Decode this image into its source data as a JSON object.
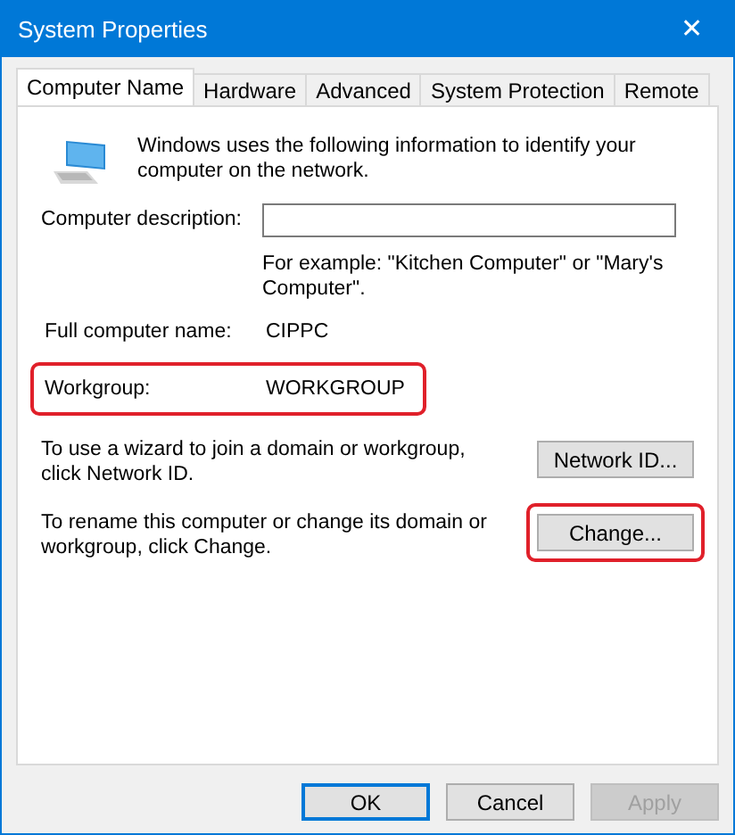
{
  "window": {
    "title": "System Properties",
    "close": "✕"
  },
  "tabs": [
    {
      "label": "Computer Name",
      "selected": true
    },
    {
      "label": "Hardware",
      "selected": false
    },
    {
      "label": "Advanced",
      "selected": false
    },
    {
      "label": "System Protection",
      "selected": false
    },
    {
      "label": "Remote",
      "selected": false
    }
  ],
  "intro": "Windows uses the following information to identify your computer on the network.",
  "description": {
    "label": "Computer description:",
    "hint": "For example: \"Kitchen Computer\" or \"Mary's Computer\"."
  },
  "fields": [
    {
      "label": "Full computer name:",
      "value": "CIPPC",
      "highlighted": false
    },
    {
      "label": "Workgroup:",
      "value": "WORKGROUP",
      "highlighted": true
    }
  ],
  "actions": [
    {
      "text": "To use a wizard to join a domain or workgroup, click Network ID.",
      "button": "Network ID...",
      "highlighted": false
    },
    {
      "text": "To rename this computer or change its domain or workgroup, click Change.",
      "button": "Change...",
      "highlighted": true
    }
  ],
  "buttons": [
    {
      "label": "OK",
      "default": true,
      "disabled": false
    },
    {
      "label": "Cancel",
      "default": false,
      "disabled": false
    },
    {
      "label": "Apply",
      "default": false,
      "disabled": true
    }
  ]
}
